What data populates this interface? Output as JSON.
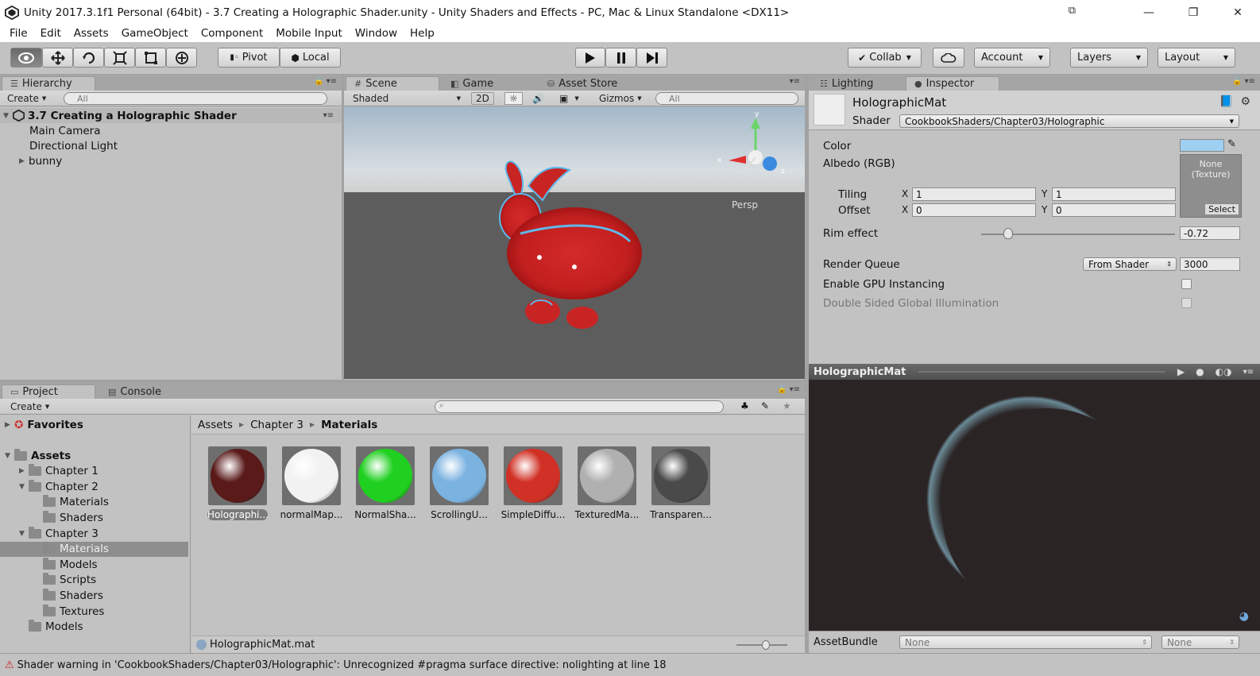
{
  "window": {
    "title": "Unity 2017.3.1f1 Personal (64bit) - 3.7 Creating a Holographic Shader.unity - Unity Shaders and Effects - PC, Mac & Linux Standalone <DX11>",
    "minimize": "—",
    "maximize": "❐",
    "close": "✕"
  },
  "menu": [
    "File",
    "Edit",
    "Assets",
    "GameObject",
    "Component",
    "Mobile Input",
    "Window",
    "Help"
  ],
  "toolbar": {
    "pivot": "Pivot",
    "local": "Local",
    "collab": "Collab",
    "account": "Account",
    "layers": "Layers",
    "layout": "Layout"
  },
  "hierarchy": {
    "tab": "Hierarchy",
    "create": "Create",
    "search_placeholder": "All",
    "scene_name": "3.7 Creating a Holographic Shader",
    "items": [
      "Main Camera",
      "Directional Light",
      "bunny"
    ]
  },
  "scene": {
    "tabs": [
      "Scene",
      "Game",
      "Asset Store"
    ],
    "shading": "Shaded",
    "mode_2d": "2D",
    "gizmos": "Gizmos",
    "search_placeholder": "All",
    "persp": "Persp",
    "axis_x": "x",
    "axis_y": "y",
    "axis_z": "z"
  },
  "inspector": {
    "tabs": [
      "Lighting",
      "Inspector"
    ],
    "material_name": "HolographicMat",
    "shader_label": "Shader",
    "shader_value": "CookbookShaders/Chapter03/Holographic",
    "color_label": "Color",
    "albedo_label": "Albedo (RGB)",
    "texture_none": "None (Texture)",
    "texture_select": "Select",
    "tiling_label": "Tiling",
    "offset_label": "Offset",
    "axis_x": "X",
    "axis_y": "Y",
    "tiling_x": "1",
    "tiling_y": "1",
    "offset_x": "0",
    "offset_y": "0",
    "rim_label": "Rim effect",
    "rim_value": "-0.72",
    "rim_fraction": 0.14,
    "render_queue_label": "Render Queue",
    "render_queue_mode": "From Shader",
    "render_queue_value": "3000",
    "gpu_instancing_label": "Enable GPU Instancing",
    "double_sided_label": "Double Sided Global Illumination",
    "color_swatch": "#9fd0f2"
  },
  "preview": {
    "title": "HolographicMat",
    "assetbundle_label": "AssetBundle",
    "assetbundle_value": "None",
    "variant_value": "None"
  },
  "project": {
    "tabs": [
      "Project",
      "Console"
    ],
    "create": "Create",
    "favorites": "Favorites",
    "tree": [
      {
        "label": "Assets",
        "depth": 0,
        "fold": "▼",
        "bold": true
      },
      {
        "label": "Chapter 1",
        "depth": 1,
        "fold": "▶",
        "bold": false
      },
      {
        "label": "Chapter 2",
        "depth": 1,
        "fold": "▼",
        "bold": false
      },
      {
        "label": "Materials",
        "depth": 2,
        "fold": "",
        "bold": false
      },
      {
        "label": "Shaders",
        "depth": 2,
        "fold": "",
        "bold": false
      },
      {
        "label": "Chapter 3",
        "depth": 1,
        "fold": "▼",
        "bold": false
      },
      {
        "label": "Materials",
        "depth": 2,
        "fold": "",
        "bold": false,
        "selected": true
      },
      {
        "label": "Models",
        "depth": 2,
        "fold": "",
        "bold": false
      },
      {
        "label": "Scripts",
        "depth": 2,
        "fold": "",
        "bold": false
      },
      {
        "label": "Shaders",
        "depth": 2,
        "fold": "",
        "bold": false
      },
      {
        "label": "Textures",
        "depth": 2,
        "fold": "",
        "bold": false
      },
      {
        "label": "Models",
        "depth": 1,
        "fold": "",
        "bold": false
      }
    ],
    "breadcrumb": [
      "Assets",
      "Chapter 3",
      "Materials"
    ],
    "assets": [
      {
        "label": "Holographi...",
        "color": "#5a1a1a",
        "selected": true
      },
      {
        "label": "normalMap...",
        "color": "#f2f2f2",
        "selected": false
      },
      {
        "label": "NormalSha...",
        "color": "#20d020",
        "selected": false
      },
      {
        "label": "ScrollingU...",
        "color": "#7ab2e0",
        "selected": false
      },
      {
        "label": "SimpleDiffu...",
        "color": "#d03025",
        "selected": false
      },
      {
        "label": "TexturedMa...",
        "color": "#b0b0b0",
        "selected": false
      },
      {
        "label": "Transparen...",
        "color": "#4a4a4a",
        "selected": false
      }
    ],
    "selected_file": "HolographicMat.mat"
  },
  "status": {
    "message": "Shader warning in 'CookbookShaders/Chapter03/Holographic': Unrecognized #pragma surface directive: nolighting at line 18"
  },
  "colors": {
    "panel": "#c2c2c2",
    "accent_selected": "#8e8e8e",
    "scene_sky": "#b8c6d0",
    "scene_ground": "#5d5d5d",
    "preview_bg": "#2b2425"
  }
}
